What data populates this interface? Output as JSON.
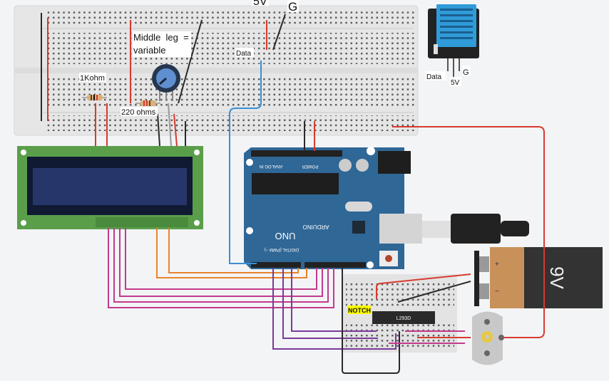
{
  "labels": {
    "five_v": "5V",
    "ground": "G",
    "middle_leg_line1": "Middle  leg  =",
    "middle_leg_line2": "variable",
    "data": "Data",
    "resistor_1k": "1Kohm",
    "resistor_220": "220 ohms",
    "sensor_data": "Data",
    "sensor_5v": "5V",
    "sensor_g": "G",
    "notch": "NOTCH"
  },
  "components": {
    "arduino_brand": "ARDUINO",
    "arduino_model": "UNO",
    "analog_header": "ANALOG IN",
    "power_header": "POWER",
    "digital_header": "DIGITAL (PWM ~)",
    "ic_name": "L293D",
    "battery": "9V",
    "battery_plus": "+",
    "battery_minus": "−"
  },
  "colors": {
    "background": "#f3f4f6",
    "breadboard": "#e6e6e6",
    "arduino": "#2f6796",
    "lcd_pcb": "#5a9e4a",
    "lcd_screen": "#27366a",
    "wire_red": "#d83a2e",
    "wire_black": "#2a2a2a",
    "wire_blue": "#3a8fd6",
    "wire_orange": "#e8842a",
    "wire_magenta": "#c23a8c",
    "wire_purple": "#7a3a9a",
    "dht_blue": "#2f9bd9",
    "notch_highlight": "#ffff00"
  }
}
